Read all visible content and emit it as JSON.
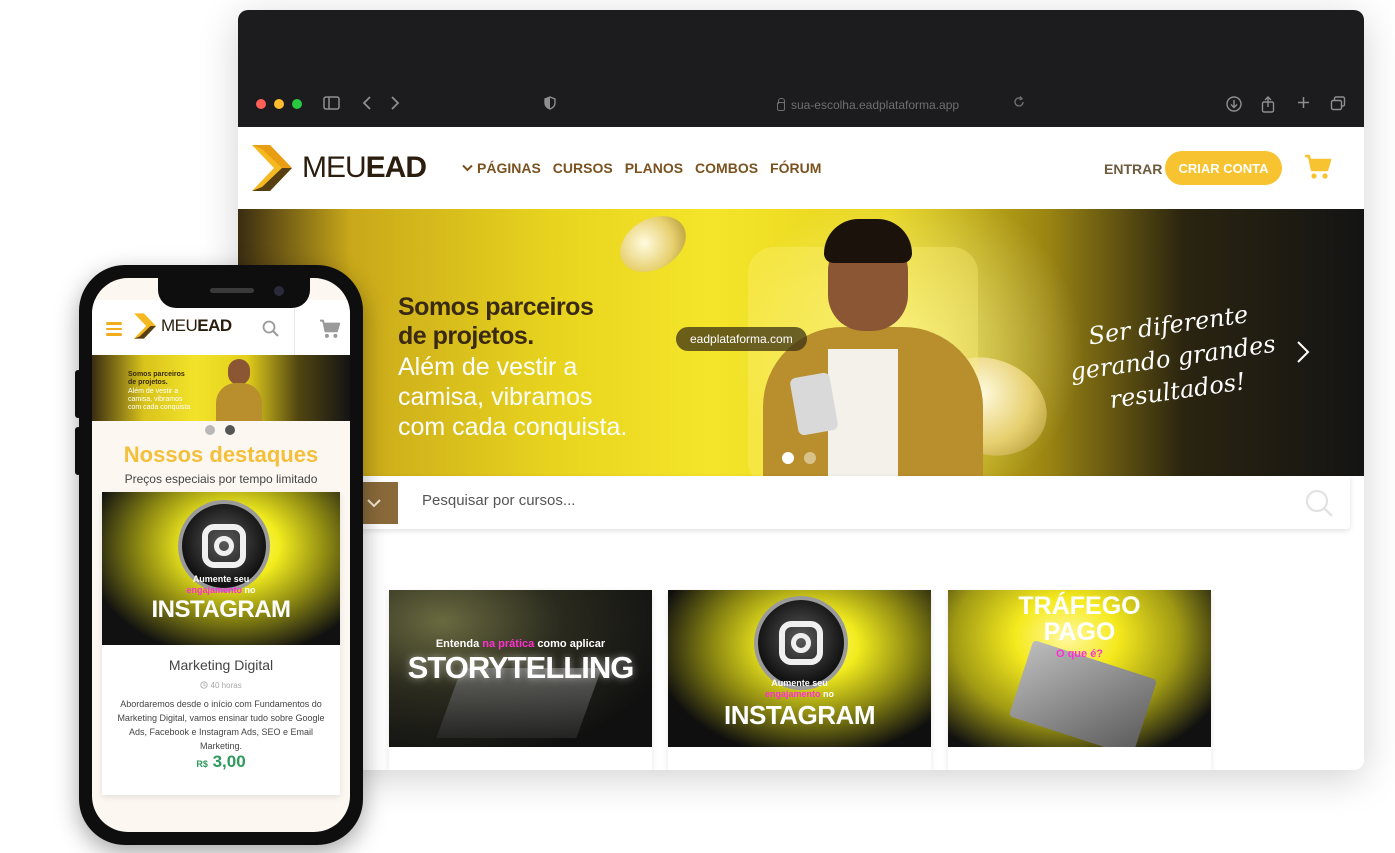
{
  "browser": {
    "url": "sua-escolha.eadplataforma.app",
    "traffic_colors": [
      "#ff5f57",
      "#febc2e",
      "#28c840"
    ]
  },
  "brand": {
    "name_light": "MEU",
    "name_bold": "EAD",
    "accent": "#f8c330",
    "nav_color": "#7a5220"
  },
  "nav": {
    "items": [
      "PÁGINAS",
      "CURSOS",
      "PLANOS",
      "COMBOS",
      "FÓRUM"
    ],
    "entrar": "ENTRAR",
    "criar_conta": "CRIAR CONTA"
  },
  "hero": {
    "title_line1": "Somos parceiros",
    "title_line2": "de projetos.",
    "sub_line1": "Além de vestir a",
    "sub_line2": "camisa, vibramos",
    "sub_line3": "com cada conquista.",
    "pill": "eadplataforma.com",
    "script_line1": "Ser diferente",
    "script_line2": "gerando grandes",
    "script_line3": "resultados!",
    "active_slide": 0,
    "slides": 2
  },
  "search": {
    "placeholder": "Pesquisar por cursos..."
  },
  "courses": [
    {
      "kind": "storytelling",
      "top": "Entenda",
      "highlight": "na prática",
      "top_end": "como aplicar",
      "main": "STORYTELLING"
    },
    {
      "kind": "instagram",
      "top": "Aumente seu",
      "highlight": "engajamento",
      "top_end": "no",
      "main": "INSTAGRAM"
    },
    {
      "kind": "trafego",
      "top": "TRÁFEGO",
      "main": "PAGO",
      "highlight": "O que é?"
    }
  ],
  "mobile": {
    "banner_title1": "Somos parceiros",
    "banner_title2": "de projetos.",
    "banner_sub1": "Além de vestir a",
    "banner_sub2": "camisa, vibramos",
    "banner_sub3": "com cada conquista",
    "section_title": "Nossos destaques",
    "section_subtitle": "Preços especiais por tempo limitado",
    "card": {
      "top": "Aumente seu",
      "highlight": "engajamento",
      "top_end": "no",
      "main": "INSTAGRAM",
      "course": "Marketing Digital",
      "hours": "40 horas",
      "description": "Abordaremos desde o início com Fundamentos do Marketing Digital, vamos ensinar tudo sobre Google Ads, Facebook e Instagram Ads, SEO e Email Marketing.",
      "currency": "R$",
      "price": "3,00"
    }
  }
}
